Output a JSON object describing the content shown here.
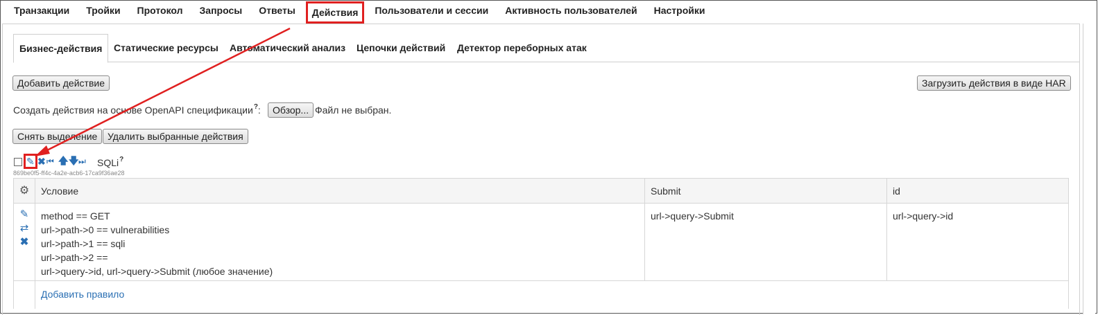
{
  "topnav": {
    "items": [
      "Транзакции",
      "Тройки",
      "Протокол",
      "Запросы",
      "Ответы",
      "Действия",
      "Пользователи и сессии",
      "Активность пользователей",
      "Настройки"
    ],
    "active": "Действия"
  },
  "subtabs": {
    "items": [
      "Бизнес-действия",
      "Статические ресурсы",
      "Автоматический анализ",
      "Цепочки действий",
      "Детектор переборных атак"
    ],
    "active": "Бизнес-действия"
  },
  "buttons": {
    "add_action": "Добавить действие",
    "upload_har": "Загрузить действия в виде HAR",
    "browse": "Обзор...",
    "deselect": "Снять выделение",
    "delete_selected": "Удалить выбранные действия"
  },
  "openapi": {
    "label": "Создать действия на основе OpenAPI спецификации",
    "colon": ":",
    "help": "?",
    "file_status": "Файл не выбран."
  },
  "action": {
    "name": "SQLi",
    "help": "?",
    "uuid": "869be0f5-ff4c-4a2e-acb6-17ca9f36ae28"
  },
  "icons": {
    "edit": "pencil-icon",
    "delete": "close-icon",
    "first": "skip-first-icon",
    "up": "arrow-up-icon",
    "down": "arrow-down-icon",
    "last": "skip-last-icon",
    "gear": "gear-icon",
    "swap": "swap-icon"
  },
  "colors": {
    "accent": "#2a6fb3",
    "highlight": "#e02020"
  },
  "table": {
    "headers": [
      "Условие",
      "Submit",
      "id"
    ],
    "rows": [
      {
        "condition": [
          "method == GET",
          "url->path->0 == vulnerabilities",
          "url->path->1 == sqli",
          "url->path->2 ==",
          "url->query->id, url->query->Submit (любое значение)"
        ],
        "submit": "url->query->Submit",
        "id": "url->query->id"
      }
    ],
    "add_rule": "Добавить правило"
  }
}
